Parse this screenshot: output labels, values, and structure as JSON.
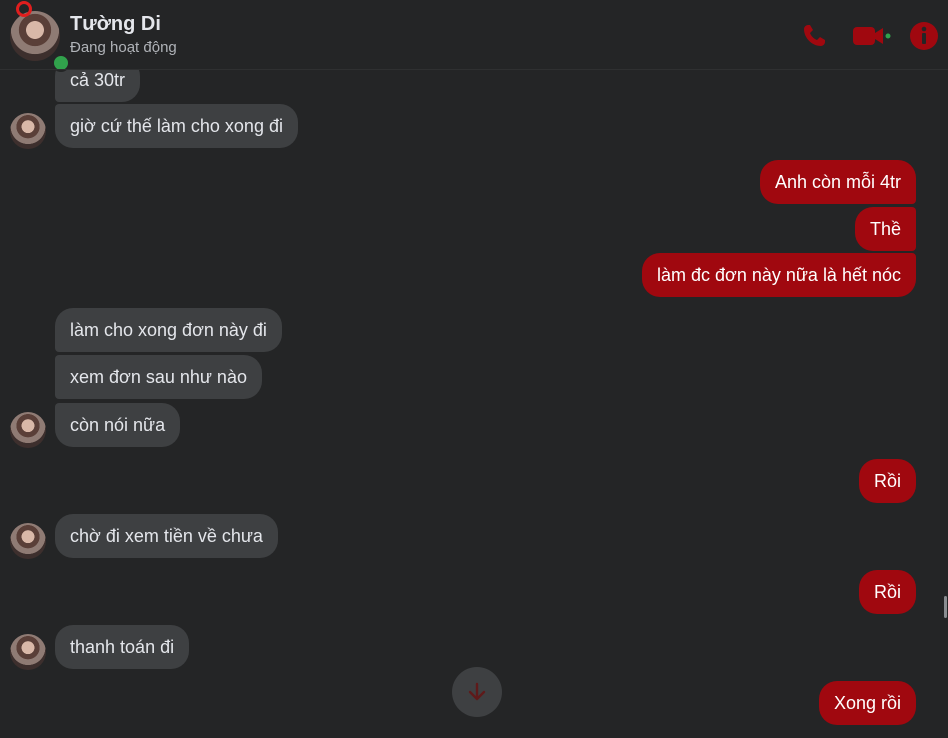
{
  "header": {
    "contact_name": "Tường Di",
    "status": "Đang hoạt động"
  },
  "colors": {
    "accent": "#a0080f",
    "incoming_bubble": "#3e4042",
    "background": "#242526",
    "online": "#31a24c"
  },
  "icons": [
    "phone-icon",
    "video-call-icon",
    "info-icon",
    "arrow-down-icon"
  ],
  "messages": [
    {
      "direction": "in",
      "text": "cả 30tr"
    },
    {
      "direction": "in",
      "text": "giờ cứ thế làm cho xong đi"
    },
    {
      "direction": "out",
      "text": "Anh còn mỗi 4tr"
    },
    {
      "direction": "out",
      "text": "Thề"
    },
    {
      "direction": "out",
      "text": "làm đc đơn này nữa là hết nóc"
    },
    {
      "direction": "in",
      "text": "làm cho xong đơn này đi"
    },
    {
      "direction": "in",
      "text": "xem đơn sau như nào"
    },
    {
      "direction": "in",
      "text": "còn nói nữa"
    },
    {
      "direction": "out",
      "text": "Rồi"
    },
    {
      "direction": "in",
      "text": "chờ đi xem tiền về chưa"
    },
    {
      "direction": "out",
      "text": "Rồi"
    },
    {
      "direction": "in",
      "text": "thanh toán đi"
    },
    {
      "direction": "out",
      "text": "Xong rồi"
    }
  ]
}
